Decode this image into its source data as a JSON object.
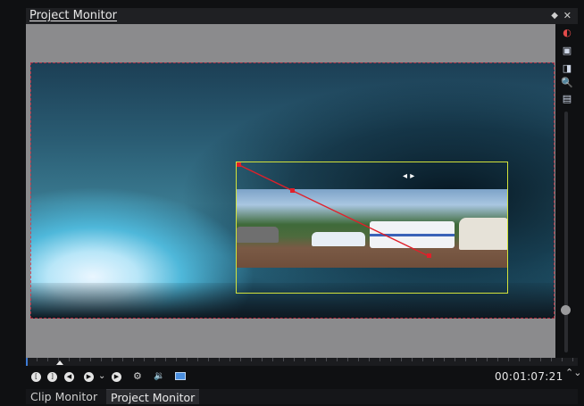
{
  "panel": {
    "title": "Project Monitor",
    "float_icon": "float-icon",
    "close_icon": "close-icon",
    "float_glyph": "◆",
    "close_glyph": "✕"
  },
  "colors": {
    "rect_outline": "#d4e33a",
    "transform_line": "#e0202a",
    "background_gray": "#8b8b8d",
    "accent_blue": "#3d7bd6"
  },
  "tools": [
    {
      "name": "red-dot-icon",
      "glyph": "◐"
    },
    {
      "name": "edit-mode-icon",
      "glyph": "▣"
    },
    {
      "name": "fit-icon",
      "glyph": "◨"
    },
    {
      "name": "zoom-icon",
      "glyph": "🔍"
    },
    {
      "name": "compare-icon",
      "glyph": "▤"
    }
  ],
  "move_handle_glyph": "◂ ▸",
  "controls": {
    "set_zone_in_glyph": "[",
    "set_zone_out_glyph": "]",
    "rewind_glyph": "◀",
    "play_glyph": "▶",
    "play_menu_glyph": "⌄",
    "forward_glyph": "▶",
    "settings_glyph": "⚙",
    "volume_glyph": "🔉"
  },
  "timecode": "00:01:07:21",
  "timecode_spin_glyph": "⌃⌄",
  "tabs": [
    {
      "label": "Clip Monitor",
      "active": false
    },
    {
      "label": "Project Monitor",
      "active": true
    }
  ]
}
